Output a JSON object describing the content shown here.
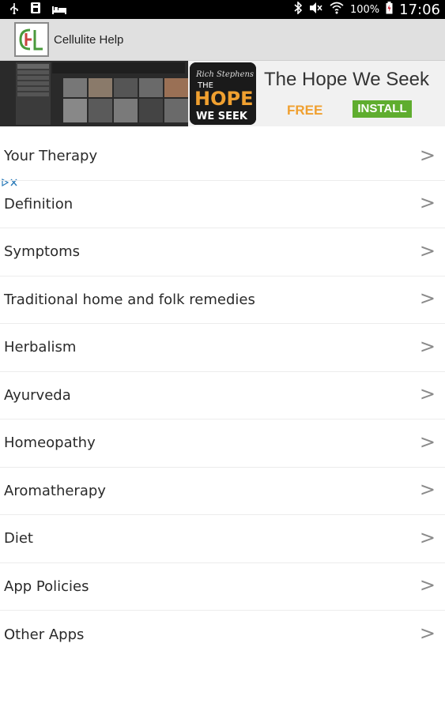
{
  "status_bar": {
    "icons_left": [
      "usb-icon",
      "sd-card-icon",
      "bed-icon"
    ],
    "icons_right": [
      "bluetooth-icon",
      "mute-icon",
      "wifi-icon"
    ],
    "battery_percent": "100%",
    "time": "17:06"
  },
  "action_bar": {
    "title": "Cellulite Help"
  },
  "ad": {
    "title": "The Hope We Seek",
    "free_label": "FREE",
    "install_label": "INSTALL"
  },
  "menu": {
    "items": [
      {
        "label": "Your Therapy",
        "arrow": ">"
      },
      {
        "label": "Definition",
        "arrow": ">"
      },
      {
        "label": "Symptoms",
        "arrow": ">"
      },
      {
        "label": "Traditional home and folk remedies",
        "arrow": ">"
      },
      {
        "label": "Herbalism",
        "arrow": ">"
      },
      {
        "label": "Ayurveda",
        "arrow": ">"
      },
      {
        "label": "Homeopathy",
        "arrow": ">"
      },
      {
        "label": "Aromatherapy",
        "arrow": ">"
      },
      {
        "label": "Diet",
        "arrow": ">"
      },
      {
        "label": "App Policies",
        "arrow": ">"
      },
      {
        "label": "Other Apps",
        "arrow": ">"
      }
    ]
  },
  "colors": {
    "action_bar_bg": "#e0e0e0",
    "install_green": "#5fad2f",
    "free_orange": "#f0a030"
  }
}
